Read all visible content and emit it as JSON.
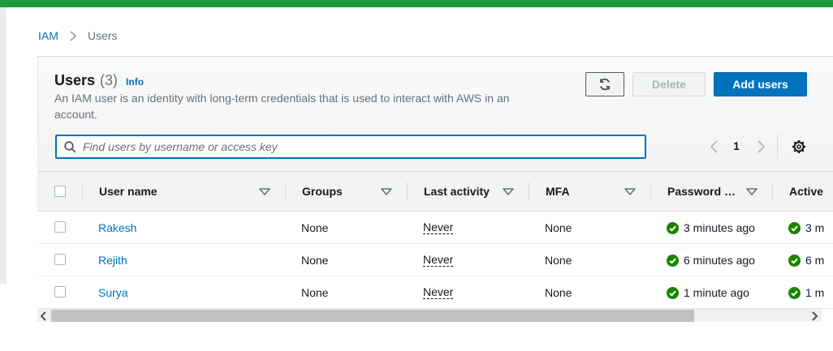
{
  "breadcrumb": {
    "root": "IAM",
    "current": "Users"
  },
  "header": {
    "title": "Users",
    "count": "(3)",
    "info": "Info",
    "description": "An IAM user is an identity with long-term credentials that is used to interact with AWS in an account."
  },
  "actions": {
    "refresh_icon": "refresh-icon",
    "delete": "Delete",
    "add_users": "Add users"
  },
  "search": {
    "placeholder": "Find users by username or access key",
    "value": ""
  },
  "pagination": {
    "page": "1"
  },
  "columns": [
    "User name",
    "Groups",
    "Last activity",
    "MFA",
    "Password …",
    "Active"
  ],
  "rows": [
    {
      "user": "Rakesh",
      "groups": "None",
      "last_activity": "Never",
      "mfa": "None",
      "password_age": "3 minutes ago",
      "active_key": "3 m"
    },
    {
      "user": "Rejith",
      "groups": "None",
      "last_activity": "Never",
      "mfa": "None",
      "password_age": "6 minutes ago",
      "active_key": "6 m"
    },
    {
      "user": "Surya",
      "groups": "None",
      "last_activity": "Never",
      "mfa": "None",
      "password_age": "1 minute ago",
      "active_key": "1 m"
    }
  ],
  "colors": {
    "accent": "#0073bb",
    "success": "#1d8102",
    "topbar": "#1d9a3a"
  }
}
